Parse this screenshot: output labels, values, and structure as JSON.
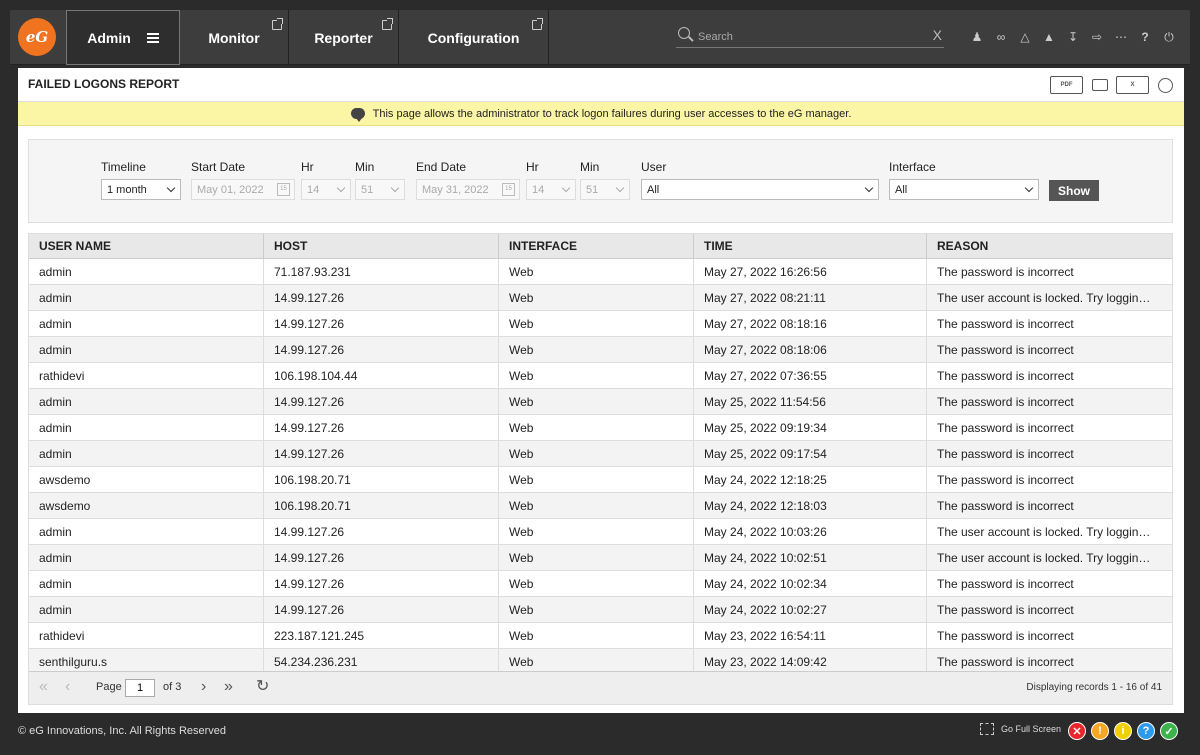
{
  "logo": {
    "text": "eG"
  },
  "nav": [
    {
      "label": "Admin"
    },
    {
      "label": "Monitor"
    },
    {
      "label": "Reporter"
    },
    {
      "label": "Configuration"
    }
  ],
  "search": {
    "placeholder": "Search",
    "clear": "X"
  },
  "panel": {
    "title": "FAILED LOGONS REPORT"
  },
  "info": {
    "text": "This page allows the administrator to track logon failures during user accesses to the eG manager."
  },
  "filters": {
    "timeline": {
      "label": "Timeline",
      "value": "1 month"
    },
    "start_date": {
      "label": "Start Date",
      "value": "May 01, 2022"
    },
    "start_hr": {
      "label": "Hr",
      "value": "14"
    },
    "start_min": {
      "label": "Min",
      "value": "51"
    },
    "end_date": {
      "label": "End Date",
      "value": "May 31, 2022"
    },
    "end_hr": {
      "label": "Hr",
      "value": "14"
    },
    "end_min": {
      "label": "Min",
      "value": "51"
    },
    "user": {
      "label": "User",
      "value": "All"
    },
    "interface": {
      "label": "Interface",
      "value": "All"
    },
    "show_label": "Show"
  },
  "table": {
    "columns": [
      "USER NAME",
      "HOST",
      "INTERFACE",
      "TIME",
      "REASON"
    ],
    "rows": [
      [
        "admin",
        "71.187.93.231",
        "Web",
        "May 27, 2022 16:26:56",
        "The password is incorrect"
      ],
      [
        "admin",
        "14.99.127.26",
        "Web",
        "May 27, 2022 08:21:11",
        "The user account is locked. Try loggin…"
      ],
      [
        "admin",
        "14.99.127.26",
        "Web",
        "May 27, 2022 08:18:16",
        "The password is incorrect"
      ],
      [
        "admin",
        "14.99.127.26",
        "Web",
        "May 27, 2022 08:18:06",
        "The password is incorrect"
      ],
      [
        "rathidevi",
        "106.198.104.44",
        "Web",
        "May 27, 2022 07:36:55",
        "The password is incorrect"
      ],
      [
        "admin",
        "14.99.127.26",
        "Web",
        "May 25, 2022 11:54:56",
        "The password is incorrect"
      ],
      [
        "admin",
        "14.99.127.26",
        "Web",
        "May 25, 2022 09:19:34",
        "The password is incorrect"
      ],
      [
        "admin",
        "14.99.127.26",
        "Web",
        "May 25, 2022 09:17:54",
        "The password is incorrect"
      ],
      [
        "awsdemo",
        "106.198.20.71",
        "Web",
        "May 24, 2022 12:18:25",
        "The password is incorrect"
      ],
      [
        "awsdemo",
        "106.198.20.71",
        "Web",
        "May 24, 2022 12:18:03",
        "The password is incorrect"
      ],
      [
        "admin",
        "14.99.127.26",
        "Web",
        "May 24, 2022 10:03:26",
        "The user account is locked. Try loggin…"
      ],
      [
        "admin",
        "14.99.127.26",
        "Web",
        "May 24, 2022 10:02:51",
        "The user account is locked. Try loggin…"
      ],
      [
        "admin",
        "14.99.127.26",
        "Web",
        "May 24, 2022 10:02:34",
        "The password is incorrect"
      ],
      [
        "admin",
        "14.99.127.26",
        "Web",
        "May 24, 2022 10:02:27",
        "The password is incorrect"
      ],
      [
        "rathidevi",
        "223.187.121.245",
        "Web",
        "May 23, 2022 16:54:11",
        "The password is incorrect"
      ],
      [
        "senthilguru.s",
        "54.234.236.231",
        "Web",
        "May 23, 2022 14:09:42",
        "The password is incorrect"
      ]
    ]
  },
  "pager": {
    "page_label": "Page",
    "page_value": "1",
    "of_label": "of 3",
    "display_text": "Displaying records 1 - 16 of 41"
  },
  "footer": {
    "copyright": "© eG Innovations, Inc. All Rights Reserved",
    "fullscreen": "Go Full Screen"
  },
  "status_colors": {
    "critical": "#e8262b",
    "major": "#f5a623",
    "minor": "#f0d000",
    "info": "#2d9be8",
    "ok": "#3cb44b"
  }
}
